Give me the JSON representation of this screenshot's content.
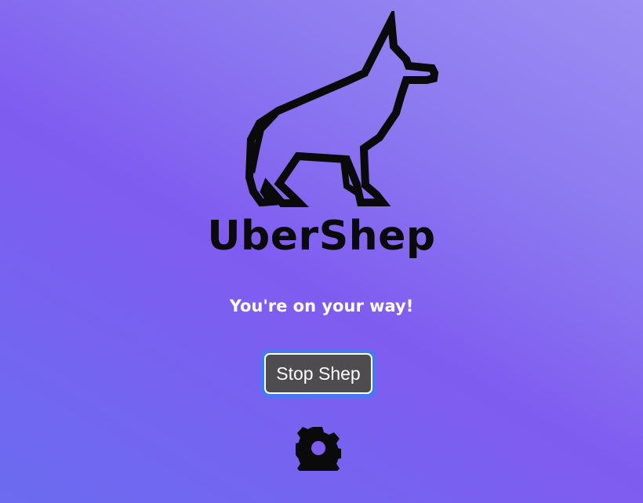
{
  "app": {
    "name": "UberShep",
    "logo_icon": "shepherd-dog-icon"
  },
  "status": {
    "message": "You're on your way!"
  },
  "actions": {
    "stop_label": "Stop Shep",
    "settings_icon": "gear-icon"
  },
  "colors": {
    "background_start": "#6b6cf0",
    "background_end": "#9c8ef3",
    "button_fill": "#4f4c4f",
    "button_focus": "#4a78f0",
    "logo": "#0a0a0a"
  }
}
